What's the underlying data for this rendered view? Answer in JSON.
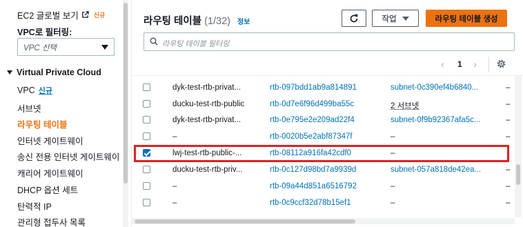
{
  "sidebar": {
    "ec2_global_view": "EC2 글로벌 보기",
    "ec2_new_badge": "신규",
    "filter_label": "VPC로 필터링:",
    "vpc_select_placeholder": "VPC 선택",
    "section_title": "Virtual Private Cloud",
    "items": [
      {
        "label": "VPC",
        "badge": "신규"
      },
      {
        "label": "서브넷"
      },
      {
        "label": "라우팅 테이블"
      },
      {
        "label": "인터넷 게이트웨이"
      },
      {
        "label": "송신 전용 인터넷 게이트웨이"
      },
      {
        "label": "캐리어 게이트웨이"
      },
      {
        "label": "DHCP 옵션 세트"
      },
      {
        "label": "탄력적 IP"
      },
      {
        "label": "관리형 접두사 목록"
      }
    ]
  },
  "panel": {
    "title": "라우팅 테이블",
    "count": "(1/32)",
    "info_link": "정보",
    "actions_label": "작업",
    "create_label": "라우팅 테이블 생성",
    "search_placeholder": "라우팅 테이블 필터링",
    "page_number": "1"
  },
  "colors": {
    "accent_orange": "#ec7211",
    "link_blue": "#0073bb",
    "highlight_red": "#e02020"
  },
  "table": {
    "rows": [
      {
        "checked": false,
        "name": "dyk-test-rtb-privat...",
        "id": "rtb-097bdd1ab9a814891",
        "subnet": "subnet-0c390ef4b6840...",
        "subnet_style": "link",
        "last": "–"
      },
      {
        "checked": false,
        "name": "ducku-test-rtb-public",
        "id": "rtb-0d7e6f96d499ba55c",
        "subnet": "2 서브넷",
        "subnet_style": "dashed",
        "last": "–"
      },
      {
        "checked": false,
        "name": "dyk-test-rtb-privat...",
        "id": "rtb-0e795e2e209ad22f4",
        "subnet": "subnet-0f9b92367afa5c...",
        "subnet_style": "link",
        "last": "–"
      },
      {
        "checked": false,
        "name": "–",
        "id": "rtb-0020b5e2abf87347f",
        "subnet": "–",
        "subnet_style": "plain",
        "last": "–"
      },
      {
        "checked": true,
        "name": "lwj-test-rtb-public-...",
        "id": "rtb-08112a916fa42cdf0",
        "subnet": "–",
        "subnet_style": "plain",
        "last": ""
      },
      {
        "checked": false,
        "name": "ducku-test-rtb-priv...",
        "id": "rtb-0c127d98bd7a9939d",
        "subnet": "subnet-057a818de42ea...",
        "subnet_style": "link",
        "last": "–"
      },
      {
        "checked": false,
        "name": "–",
        "id": "rtb-09a44d851a6516792",
        "subnet": "–",
        "subnet_style": "plain",
        "last": "–"
      },
      {
        "checked": false,
        "name": "–",
        "id": "rtb-0c9ccf32d78b15ef1",
        "subnet": "–",
        "subnet_style": "plain",
        "last": "–"
      }
    ]
  }
}
